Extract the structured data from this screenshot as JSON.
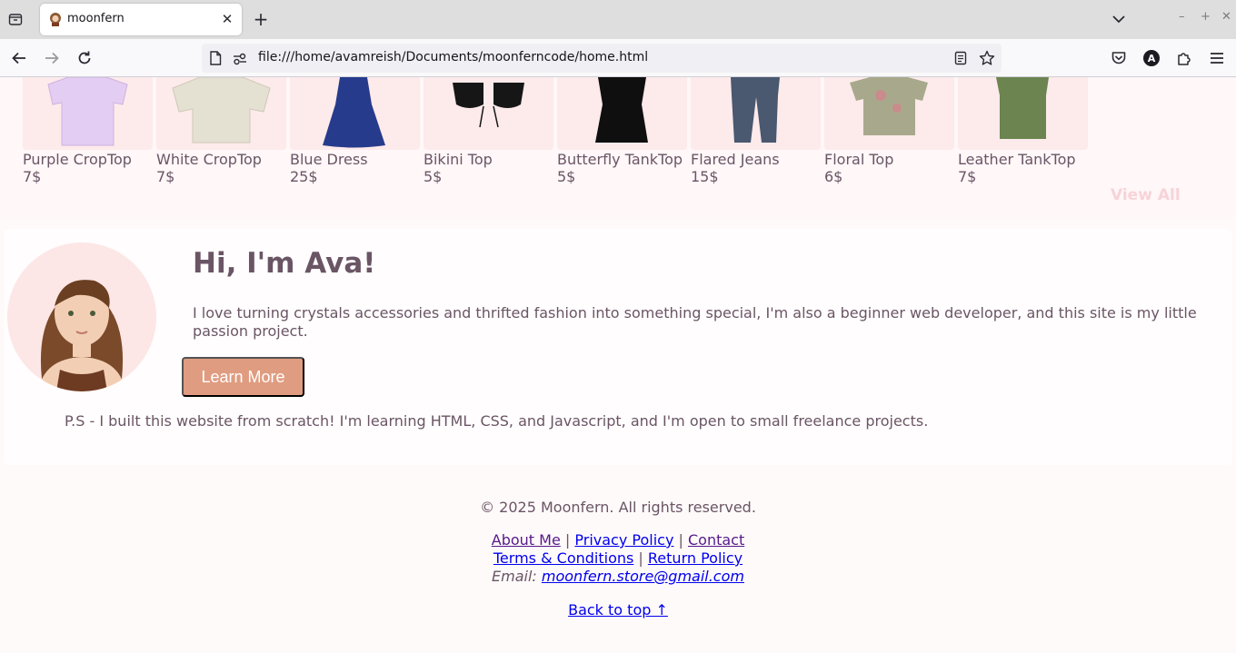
{
  "browser": {
    "tab_title": "moonfern",
    "url": "file:///home/avamreish/Documents/moonferncode/home.html",
    "profile_initial": "A"
  },
  "products": [
    {
      "name": "Purple CropTop",
      "price": "7$",
      "color": "#e3cdf2"
    },
    {
      "name": "White CropTop",
      "price": "7$",
      "color": "#e4e0d2"
    },
    {
      "name": "Blue Dress",
      "price": "25$",
      "color": "#263b8c"
    },
    {
      "name": "Bikini Top",
      "price": "5$",
      "color": "#161616"
    },
    {
      "name": "Butterfly TankTop",
      "price": "5$",
      "color": "#0f0f0f"
    },
    {
      "name": "Flared Jeans",
      "price": "15$",
      "color": "#4a5870"
    },
    {
      "name": "Floral Top",
      "price": "6$",
      "color": "#a8a98c"
    },
    {
      "name": "Leather TankTop",
      "price": "7$",
      "color": "#6b8450"
    }
  ],
  "view_all_label": "View All",
  "about": {
    "heading": "Hi, I'm Ava!",
    "text": "I love turning crystals accessories and thrifted fashion into something special, I'm also a beginner web developer, and this site is my little passion project.",
    "button_label": "Learn More",
    "ps": "P.S - I built this website from scratch! I'm learning HTML, CSS, and Javascript, and I'm open to small freelance projects."
  },
  "footer": {
    "copyright": "© 2025 Moonfern. All rights reserved.",
    "about_me": "About Me",
    "privacy": "Privacy Policy",
    "contact": "Contact",
    "terms": "Terms & Conditions",
    "returns": "Return Policy",
    "separator": "|",
    "email_label": "Email:",
    "email": "moonfern.store@gmail.com",
    "back_to_top": "Back to top ↑"
  },
  "colors": {
    "text": "#6a5565",
    "button": "#e09c80",
    "view_all": "#f7d3d8",
    "product_bg": "#fdeaea",
    "link": "#0000ee",
    "link_visited": "#551a8b"
  }
}
